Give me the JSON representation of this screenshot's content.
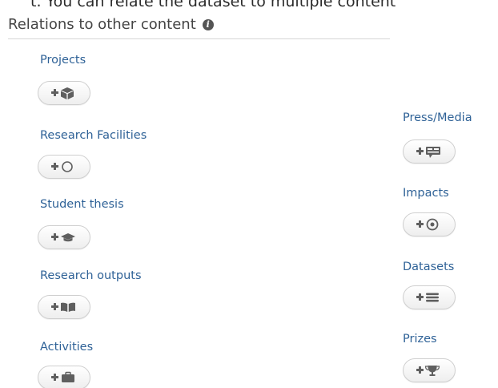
{
  "intro_text": "t. You can relate the dataset to multiple content",
  "section": {
    "title": "Relations to other content"
  },
  "colors": {
    "link": "#2f6297",
    "icon": "#5f5f5f",
    "heading": "#444444"
  },
  "relations": {
    "left": [
      {
        "label": "Projects",
        "icon": "cube-icon"
      },
      {
        "label": "Research Facilities",
        "icon": "ring-icon"
      },
      {
        "label": "Student thesis",
        "icon": "graduation-cap-icon"
      },
      {
        "label": "Research outputs",
        "icon": "book-icon"
      },
      {
        "label": "Activities",
        "icon": "briefcase-icon"
      }
    ],
    "right": [
      {
        "label": "Press/Media",
        "icon": "media-icon"
      },
      {
        "label": "Impacts",
        "icon": "target-icon"
      },
      {
        "label": "Datasets",
        "icon": "list-icon"
      },
      {
        "label": "Prizes",
        "icon": "trophy-icon"
      }
    ]
  }
}
